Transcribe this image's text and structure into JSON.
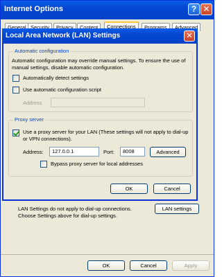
{
  "outer_window": {
    "title": "Internet Options",
    "help_glyph": "?",
    "close_glyph": "✕",
    "tabs": [
      {
        "label": "General"
      },
      {
        "label": "Security"
      },
      {
        "label": "Privacy"
      },
      {
        "label": "Content"
      },
      {
        "label": "Connections"
      },
      {
        "label": "Programs"
      },
      {
        "label": "Advanced"
      }
    ],
    "active_tab": "Connections",
    "lan_text": "LAN Settings do not apply to dial-up connections. Choose Settings above for dial-up settings.",
    "lan_settings_button": "LAN settings",
    "footer": {
      "ok": "OK",
      "cancel": "Cancel",
      "apply": "Apply"
    }
  },
  "lan_dialog": {
    "title": "Local Area Network (LAN) Settings",
    "close_glyph": "✕",
    "auto_config": {
      "legend": "Automatic configuration",
      "description": "Automatic configuration may override manual settings.  To ensure the use of manual settings, disable automatic configuration.",
      "auto_detect_label": "Automatically detect settings",
      "auto_detect_checked": false,
      "use_script_label": "Use automatic configuration script",
      "use_script_checked": false,
      "address_label": "Address",
      "address_value": ""
    },
    "proxy": {
      "legend": "Proxy server",
      "use_proxy_label": "Use a proxy server for your LAN (These settings will not apply to dial-up or VPN connections).",
      "use_proxy_checked": true,
      "address_label": "Address:",
      "address_value": "127.0.0.1",
      "port_label": "Port:",
      "port_value": "8008",
      "advanced_button": "Advanced",
      "bypass_label": "Bypass proxy server for local addresses",
      "bypass_checked": false
    },
    "ok_button": "OK",
    "cancel_button": "Cancel"
  },
  "colors": {
    "title_bar": "#0546d1",
    "dialog_bg": "#ece9d8",
    "group_legend": "#0046d5",
    "active_tab_accent": "#ffc83c"
  }
}
